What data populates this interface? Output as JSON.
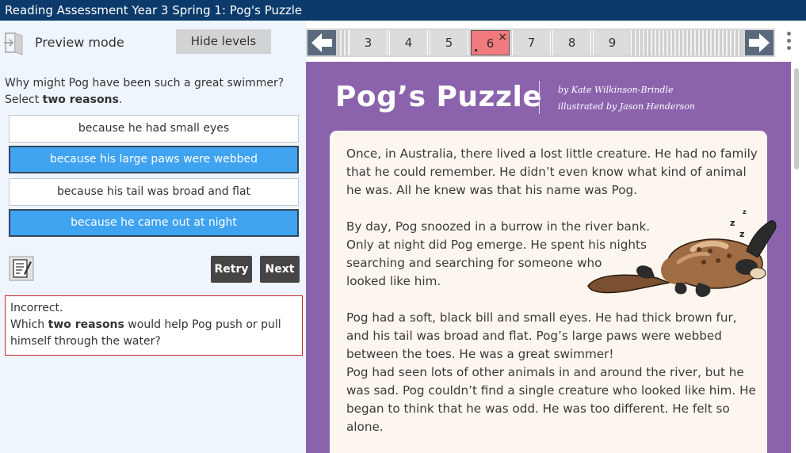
{
  "window": {
    "title": "Reading Assessment Year 3 Spring 1: Pog's Puzzle"
  },
  "left_panel": {
    "preview_label": "Preview mode",
    "hide_levels_label": "Hide levels",
    "question": {
      "line1": "Why might Pog have been such a great swimmer?",
      "line2_prefix": "Select ",
      "line2_bold": "two reasons",
      "line2_suffix": "."
    },
    "options": [
      {
        "label": "because he had small eyes",
        "selected": false
      },
      {
        "label": "because his large paws were webbed",
        "selected": true
      },
      {
        "label": "because his tail was broad and flat",
        "selected": false
      },
      {
        "label": "because he came out at night",
        "selected": true
      }
    ],
    "retry_label": "Retry",
    "next_label": "Next",
    "feedback": {
      "status": "Incorrect.",
      "prefix": "Which ",
      "bold": "two reasons",
      "suffix": " would help Pog push or pull",
      "line3": "himself through the water?"
    }
  },
  "navigation": {
    "pages": [
      "3",
      "4",
      "5",
      "6",
      "7",
      "8",
      "9"
    ],
    "current_page": "6",
    "current_mark": "×"
  },
  "document": {
    "title": "Pog’s Puzzle",
    "author": "by Kate Wilkinson-Brindle",
    "illustrator": "illustrated by Jason Henderson",
    "paragraphs": [
      [
        "Once, in Australia, there lived a lost little creature. He had no family",
        "that he could remember. He didn’t even know what kind of animal",
        "he was. All he knew was that his name was Pog."
      ],
      [
        "By day, Pog snoozed in a burrow in the river bank.",
        "Only at night did Pog emerge. He spent his nights",
        "searching and searching for someone who",
        "looked like him."
      ],
      [
        "Pog had a soft, black bill and small eyes. He had thick brown fur,",
        "and his tail was broad and flat. Pog’s large paws were webbed",
        "between the toes. He was a great swimmer!",
        "Pog had seen lots of other animals in and around the river, but he",
        "was sad. Pog couldn’t find a single creature who looked like him. He",
        "began to think that he was odd. He was too different. He felt so",
        "alone."
      ]
    ],
    "sleep_marks": [
      "z",
      "z",
      "z"
    ]
  },
  "colors": {
    "title_bar": "#0b3a6b",
    "selected_option": "#3fa3f0",
    "document_background": "#8b63ad",
    "current_page_tab": "#f07a7e",
    "feedback_border": "#c8242a"
  },
  "icons": {
    "preview": "exit-door-icon",
    "notes": "notepad-pencil-icon",
    "prev": "arrow-left-icon",
    "next": "arrow-right-icon",
    "menu": "kebab-menu-icon"
  }
}
